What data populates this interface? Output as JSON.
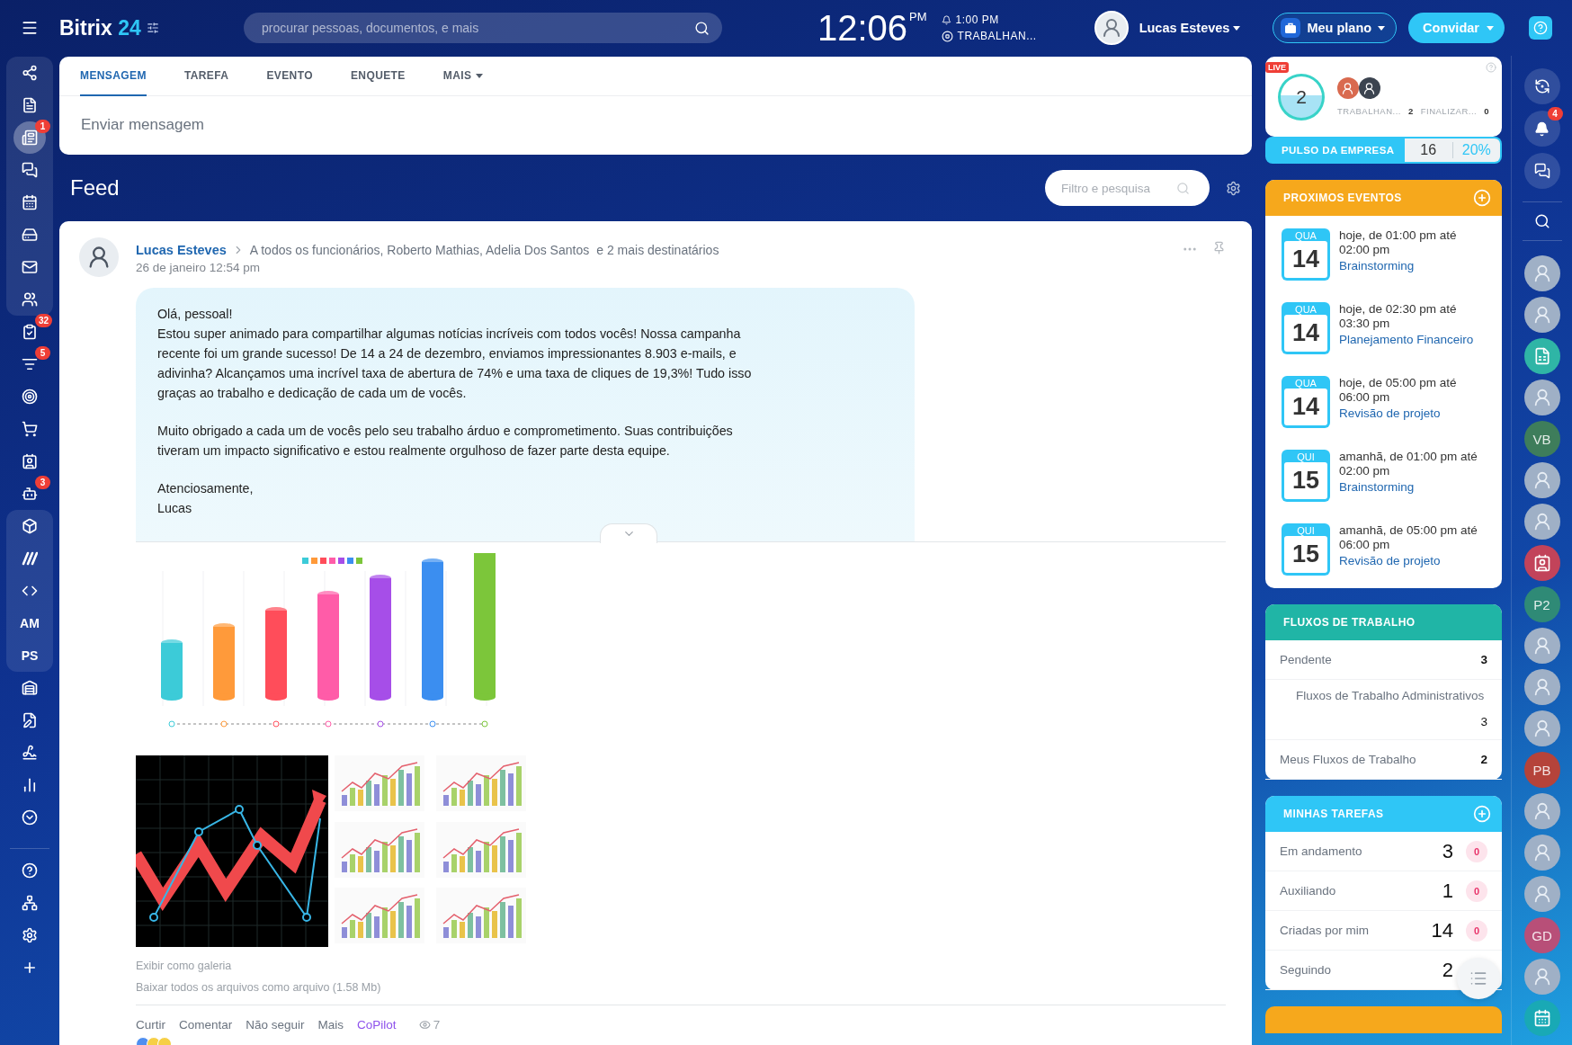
{
  "top_bar": {
    "logo_name": "Bitrix",
    "logo_number": "24",
    "search_placeholder": "procurar pessoas, documentos, e mais",
    "clock": "12:06",
    "clock_suffix": "PM",
    "alarm_time": "1:00 PM",
    "work_status": "TRABALHAN...",
    "user_name": "Lucas Esteves",
    "plan_button": "Meu plano",
    "invite_button": "Convidar"
  },
  "sidebar": {
    "groups": [
      {
        "kind": "panel",
        "items": [
          {
            "kind": "icon",
            "selected": false
          },
          {
            "kind": "icon",
            "selected": false
          },
          {
            "kind": "icon",
            "selected": true,
            "badge": "1"
          },
          {
            "kind": "icon",
            "selected": false
          },
          {
            "kind": "icon",
            "selected": false
          },
          {
            "kind": "icon",
            "selected": false
          },
          {
            "kind": "icon",
            "selected": false
          },
          {
            "kind": "icon",
            "selected": false
          }
        ]
      },
      {
        "kind": "plain",
        "items": [
          {
            "kind": "icon",
            "selected": false,
            "badge": "32"
          },
          {
            "kind": "icon",
            "selected": false,
            "badge": "5"
          },
          {
            "kind": "icon",
            "selected": false
          },
          {
            "kind": "icon",
            "selected": false
          },
          {
            "kind": "icon",
            "selected": false
          },
          {
            "kind": "icon",
            "selected": false,
            "badge": "3"
          }
        ]
      },
      {
        "kind": "panel",
        "items": [
          {
            "kind": "icon",
            "selected": false
          },
          {
            "kind": "icon",
            "selected": false
          },
          {
            "kind": "icon",
            "selected": false
          },
          {
            "kind": "text",
            "label": "AM",
            "selected": false
          },
          {
            "kind": "text",
            "label": "PS",
            "selected": false
          }
        ]
      },
      {
        "kind": "plain",
        "items": [
          {
            "kind": "icon",
            "selected": false
          },
          {
            "kind": "icon",
            "selected": false
          },
          {
            "kind": "icon",
            "selected": false
          },
          {
            "kind": "icon",
            "selected": false
          },
          {
            "kind": "icon",
            "selected": false
          }
        ]
      },
      {
        "kind": "footer",
        "items": [
          {
            "kind": "icon",
            "selected": false
          },
          {
            "kind": "icon",
            "selected": false
          },
          {
            "kind": "icon",
            "selected": false
          },
          {
            "kind": "icon",
            "selected": false
          }
        ]
      }
    ]
  },
  "composer": {
    "tabs": [
      {
        "label": "MENSAGEM",
        "selected": true,
        "dropdown": false
      },
      {
        "label": "TAREFA",
        "selected": false,
        "dropdown": false
      },
      {
        "label": "EVENTO",
        "selected": false,
        "dropdown": false
      },
      {
        "label": "ENQUETE",
        "selected": false,
        "dropdown": false
      },
      {
        "label": "MAIS",
        "selected": false,
        "dropdown": true
      }
    ],
    "placeholder": "Enviar mensagem"
  },
  "feed": {
    "title": "Feed",
    "filter_placeholder": "Filtro e pesquisa"
  },
  "post": {
    "author": "Lucas Esteves",
    "recipients": "A todos os funcionários, Roberto Mathias, Adelia Dos Santos",
    "more_recipients": "e 2 mais destinatários",
    "date": "26 de janeiro 12:54 pm",
    "message": [
      {
        "lines": [
          "Olá, pessoal!",
          "Estou super animado para compartilhar algumas notícias incríveis com todos vocês! Nossa campanha recente foi um grande sucesso! De 14 a 24 de dezembro, enviamos impressionantes 8.903 e-mails, e adivinha? Alcançamos uma incrível taxa de abertura de 74% e uma taxa de cliques de 19,3%! Tudo isso graças ao trabalho e dedicação de cada um de vocês."
        ]
      },
      {
        "lines": [
          "Muito obrigado a cada um de vocês pelo seu trabalho árduo e comprometimento. Suas contribuições tiveram um impacto significativo e estou realmente orgulhoso de fazer parte desta equipe."
        ]
      },
      {
        "lines": [
          "Atenciosamente,",
          "Lucas"
        ]
      }
    ],
    "gallery_link": "Exibir como galeria",
    "download_link": "Baixar todos os arquivos como arquivo (1.58 Mb)",
    "actions": [
      {
        "label": "Curtir",
        "kind": "plain"
      },
      {
        "label": "Comentar",
        "kind": "plain"
      },
      {
        "label": "Não seguir",
        "kind": "plain"
      },
      {
        "label": "Mais",
        "kind": "plain"
      },
      {
        "label": "CoPilot",
        "kind": "copilot"
      }
    ],
    "views": "7"
  },
  "live_card": {
    "badge": "LIVE",
    "count": "2",
    "stats": [
      {
        "label": "TRABALHAN...",
        "value": "2"
      },
      {
        "label": "FINALIZAR...",
        "value": "0"
      }
    ]
  },
  "pulse": {
    "label": "PULSO DA EMPRESA",
    "value": "16",
    "percent": "20%"
  },
  "events": {
    "title": "PROXIMOS EVENTOS",
    "items": [
      {
        "weekday": "QUA",
        "day": "14",
        "time": "hoje, de 01:00 pm até 02:00 pm",
        "title": "Brainstorming"
      },
      {
        "weekday": "QUA",
        "day": "14",
        "time": "hoje, de 02:30 pm até 03:30 pm",
        "title": "Planejamento Financeiro"
      },
      {
        "weekday": "QUA",
        "day": "14",
        "time": "hoje, de 05:00 pm até 06:00 pm",
        "title": "Revisão de projeto"
      },
      {
        "weekday": "QUI",
        "day": "15",
        "time": "amanhã, de 01:00 pm até 02:00 pm",
        "title": "Brainstorming"
      },
      {
        "weekday": "QUI",
        "day": "15",
        "time": "amanhã, de 05:00 pm até 06:00 pm",
        "title": "Revisão de projeto"
      }
    ]
  },
  "workflows": {
    "title": "FLUXOS DE TRABALHO",
    "rows": [
      {
        "label": "Pendente",
        "count": "3",
        "kind": "main"
      },
      {
        "label": "Fluxos de Trabalho Administrativos",
        "count": "3",
        "kind": "sub"
      },
      {
        "label": "Meus Fluxos de Trabalho",
        "count": "2",
        "kind": "main"
      }
    ]
  },
  "tasks": {
    "title": "MINHAS TAREFAS",
    "rows": [
      {
        "label": "Em andamento",
        "count": "3",
        "overdue": "0"
      },
      {
        "label": "Auxiliando",
        "count": "1",
        "overdue": "0"
      },
      {
        "label": "Criadas por mim",
        "count": "14",
        "overdue": "0"
      },
      {
        "label": "Seguindo",
        "count": "2"
      }
    ]
  },
  "right_bar": {
    "notifications_badge": "4",
    "contacts": [
      {
        "kind": "photo"
      },
      {
        "kind": "photo"
      },
      {
        "kind": "document"
      },
      {
        "kind": "photo"
      },
      {
        "kind": "initials",
        "initials": "VB",
        "color": "#3e7d5b"
      },
      {
        "kind": "photo"
      },
      {
        "kind": "photo"
      },
      {
        "kind": "contact"
      },
      {
        "kind": "initials",
        "initials": "P2",
        "color": "#2f8a76"
      },
      {
        "kind": "photo"
      },
      {
        "kind": "photo"
      },
      {
        "kind": "photo"
      },
      {
        "kind": "initials",
        "initials": "PB",
        "color": "#b5433a"
      },
      {
        "kind": "photo"
      },
      {
        "kind": "photo"
      },
      {
        "kind": "photo"
      },
      {
        "kind": "initials",
        "initials": "GD",
        "color": "#b84f78"
      },
      {
        "kind": "photo"
      },
      {
        "kind": "calendar"
      }
    ]
  }
}
